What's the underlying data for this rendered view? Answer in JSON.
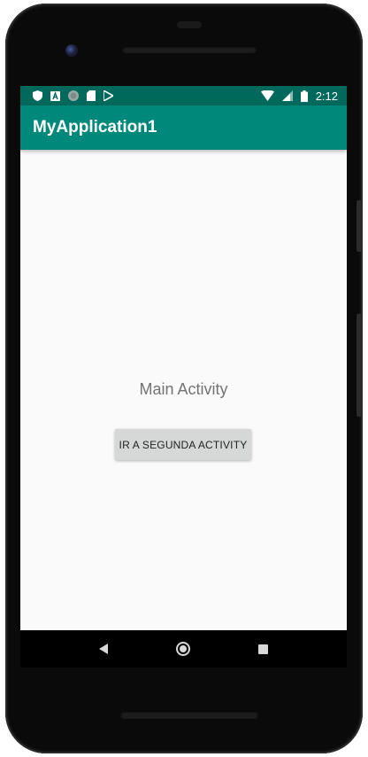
{
  "status_bar": {
    "time": "2:12",
    "left_icons": [
      "shield-icon",
      "a-icon",
      "circle-icon",
      "sd-card-icon",
      "play-store-icon"
    ],
    "right_icons": [
      "wifi-icon",
      "cell-signal-icon",
      "battery-icon"
    ]
  },
  "toolbar": {
    "title": "MyApplication1"
  },
  "main": {
    "label": "Main Activity",
    "button_label": "IR A SEGUNDA ACTIVITY"
  },
  "nav_bar": {
    "buttons": [
      "back",
      "home",
      "recents"
    ]
  },
  "colors": {
    "status_bar": "#00695c",
    "toolbar": "#00897b",
    "background": "#fafafa",
    "button": "#d6d7d7",
    "label_text": "#737373"
  }
}
